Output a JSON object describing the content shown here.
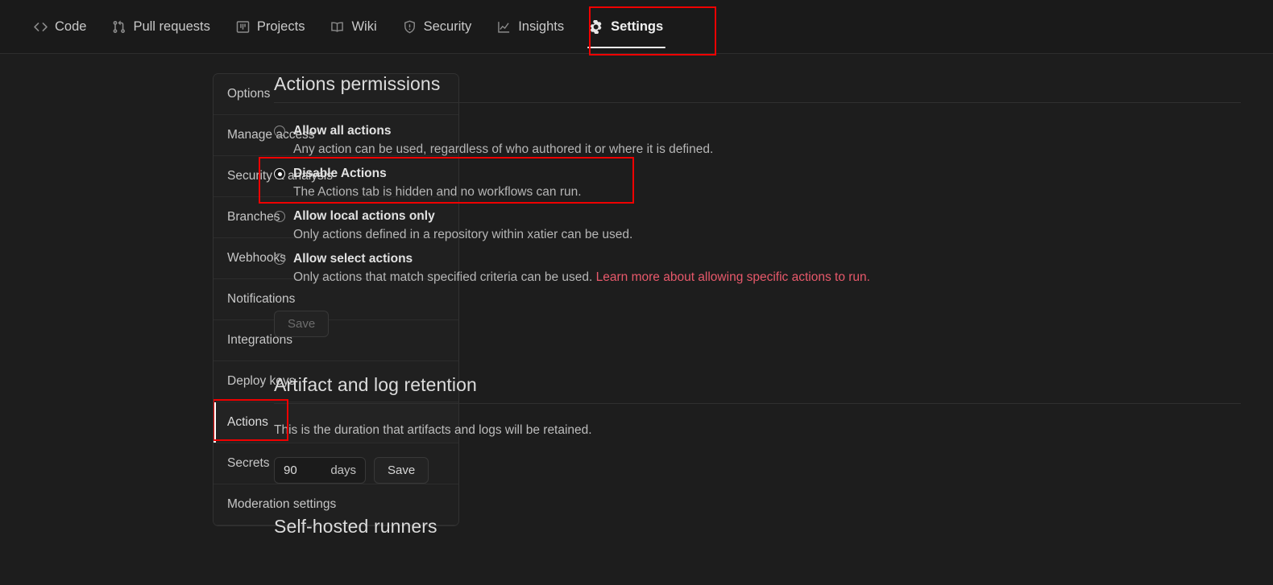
{
  "header": {
    "tabs": [
      {
        "label": "Code",
        "icon": "code-icon",
        "selected": false
      },
      {
        "label": "Pull requests",
        "icon": "pull-request-icon",
        "selected": false
      },
      {
        "label": "Projects",
        "icon": "project-board-icon",
        "selected": false
      },
      {
        "label": "Wiki",
        "icon": "book-icon",
        "selected": false
      },
      {
        "label": "Security",
        "icon": "shield-icon",
        "selected": false
      },
      {
        "label": "Insights",
        "icon": "graph-icon",
        "selected": false
      },
      {
        "label": "Settings",
        "icon": "gear-icon",
        "selected": true
      }
    ]
  },
  "sidebar": {
    "items": [
      {
        "label": "Options",
        "selected": false
      },
      {
        "label": "Manage access",
        "selected": false
      },
      {
        "label": "Security & analysis",
        "selected": false
      },
      {
        "label": "Branches",
        "selected": false
      },
      {
        "label": "Webhooks",
        "selected": false
      },
      {
        "label": "Notifications",
        "selected": false
      },
      {
        "label": "Integrations",
        "selected": false
      },
      {
        "label": "Deploy keys",
        "selected": false
      },
      {
        "label": "Actions",
        "selected": true
      },
      {
        "label": "Secrets",
        "selected": false
      },
      {
        "label": "Moderation settings",
        "selected": false
      }
    ]
  },
  "permissions": {
    "title": "Actions permissions",
    "options": [
      {
        "label": "Allow all actions",
        "description": "Any action can be used, regardless of who authored it or where it is defined.",
        "checked": false
      },
      {
        "label": "Disable Actions",
        "description": "The Actions tab is hidden and no workflows can run.",
        "checked": true
      },
      {
        "label": "Allow local actions only",
        "description": "Only actions defined in a repository within xatier can be used.",
        "checked": false
      },
      {
        "label": "Allow select actions",
        "description": "Only actions that match specified criteria can be used.",
        "link_text": "Learn more about allowing specific actions to run.",
        "checked": false
      }
    ],
    "save_label": "Save",
    "save_disabled": true
  },
  "retention": {
    "title": "Artifact and log retention",
    "description": "This is the duration that artifacts and logs will be retained.",
    "days_value": "90",
    "days_placeholder": "90",
    "unit_label": "days",
    "save_label": "Save"
  },
  "runners": {
    "title": "Self-hosted runners"
  },
  "colors": {
    "annotation": "#ef0000",
    "link": "#e8596b",
    "selected_indicator": "#ffffff",
    "page_bg": "#1d1d1d",
    "header_bg": "#1a1a1a"
  }
}
